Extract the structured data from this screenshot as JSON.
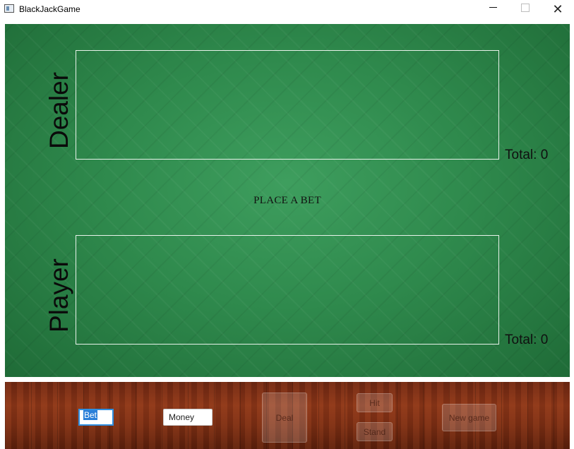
{
  "window": {
    "title": "BlackJackGame",
    "minimize_label": "",
    "maximize_label": "",
    "close_label": "✕"
  },
  "table": {
    "dealer_label": "Dealer",
    "player_label": "Player",
    "dealer_total": "Total: 0",
    "player_total": "Total: 0",
    "status": "PLACE A BET"
  },
  "controls": {
    "bet_value": "Bet",
    "money_placeholder": "Money",
    "deal_label": "Deal",
    "hit_label": "Hit",
    "stand_label": "Stand",
    "new_game_label": "New game"
  },
  "colors": {
    "felt": "#2f8a4d",
    "wood": "#7a2d13",
    "focus_border": "#2f8fe0"
  }
}
